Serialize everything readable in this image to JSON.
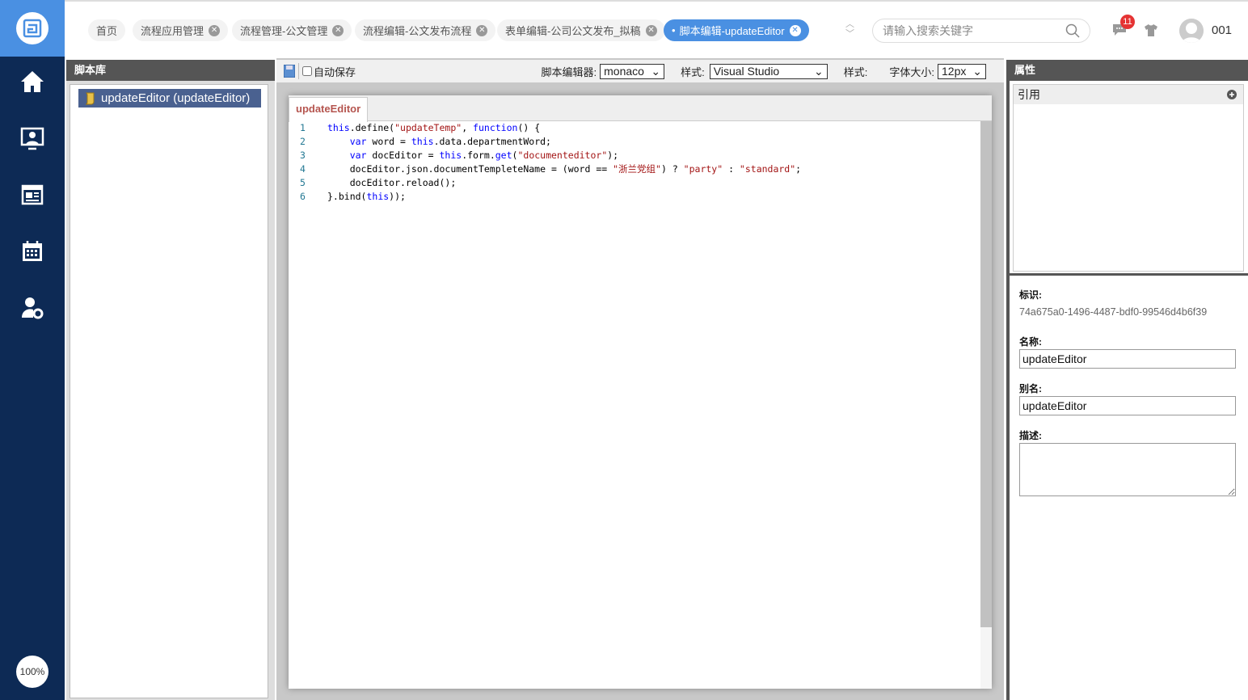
{
  "sidebar": {
    "items": [
      {
        "icon": "home-icon"
      },
      {
        "icon": "user-board-icon"
      },
      {
        "icon": "news-icon"
      },
      {
        "icon": "calendar-icon"
      },
      {
        "icon": "user-settings-icon"
      }
    ],
    "zoom": "100%"
  },
  "header": {
    "tabs": [
      {
        "label": "首页",
        "closable": false
      },
      {
        "label": "流程应用管理",
        "closable": true
      },
      {
        "label": "流程管理-公文管理",
        "closable": true
      },
      {
        "label": "流程编辑-公文发布流程",
        "closable": true
      },
      {
        "label": "表单编辑-公司公文发布_拟稿",
        "closable": true
      },
      {
        "label": "脚本编辑-updateEditor",
        "closable": true,
        "active": true
      }
    ],
    "search_placeholder": "请输入搜索关键字",
    "message_count": "11",
    "user": "001"
  },
  "left": {
    "title": "脚本库",
    "item": "updateEditor (updateEditor)"
  },
  "toolbar": {
    "autosave": "自动保存",
    "editor_label": "脚本编辑器:",
    "editor_value": "monaco",
    "style_label": "样式:",
    "style_value": "Visual Studio",
    "style2_label": "样式:",
    "font_label": "字体大小:",
    "font_value": "12px"
  },
  "editor": {
    "tab": "updateEditor",
    "lines": [
      [
        [
          "kw",
          "this"
        ],
        [
          "pl",
          ".define("
        ],
        [
          "str",
          "\"updateTemp\""
        ],
        [
          "pl",
          ", "
        ],
        [
          "kw",
          "function"
        ],
        [
          "pl",
          "() {"
        ]
      ],
      [
        [
          "pl",
          "    "
        ],
        [
          "kw",
          "var"
        ],
        [
          "pl",
          " word = "
        ],
        [
          "kw",
          "this"
        ],
        [
          "pl",
          ".data.departmentWord;"
        ]
      ],
      [
        [
          "pl",
          "    "
        ],
        [
          "kw",
          "var"
        ],
        [
          "pl",
          " docEditor = "
        ],
        [
          "kw",
          "this"
        ],
        [
          "pl",
          ".form."
        ],
        [
          "kw",
          "get"
        ],
        [
          "pl",
          "("
        ],
        [
          "str",
          "\"documenteditor\""
        ],
        [
          "pl",
          ");"
        ]
      ],
      [
        [
          "pl",
          "    docEditor.json.documentTempleteName = (word == "
        ],
        [
          "str",
          "\"浙兰党组\""
        ],
        [
          "pl",
          ") ? "
        ],
        [
          "str",
          "\"party\""
        ],
        [
          "pl",
          " : "
        ],
        [
          "str",
          "\"standard\""
        ],
        [
          "pl",
          ";"
        ]
      ],
      [
        [
          "pl",
          "    docEditor.reload();"
        ]
      ],
      [
        [
          "pl",
          "}.bind("
        ],
        [
          "kw",
          "this"
        ],
        [
          "pl",
          "));"
        ]
      ]
    ]
  },
  "props": {
    "title": "属性",
    "ref_label": "引用",
    "id_label": "标识:",
    "id_value": "74a675a0-1496-4487-bdf0-99546d4b6f39",
    "name_label": "名称:",
    "name_value": "updateEditor",
    "alias_label": "别名:",
    "alias_value": "updateEditor",
    "desc_label": "描述:",
    "desc_value": ""
  }
}
